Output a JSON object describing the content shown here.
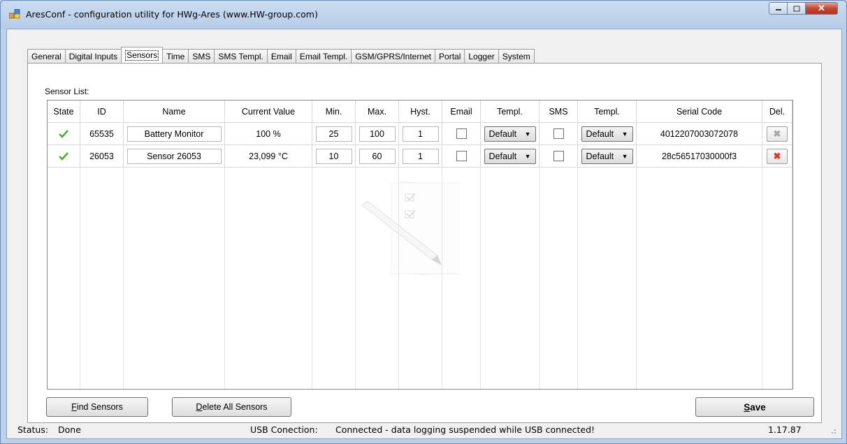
{
  "window": {
    "title": "AresConf - configuration utility for HWg-Ares (www.HW-group.com)",
    "icon": "app-window-icon"
  },
  "tabs": [
    {
      "label": "General"
    },
    {
      "label": "Digital Inputs"
    },
    {
      "label": "Sensors"
    },
    {
      "label": "Time"
    },
    {
      "label": "SMS"
    },
    {
      "label": "SMS Templ."
    },
    {
      "label": "Email"
    },
    {
      "label": "Email Templ."
    },
    {
      "label": "GSM/GPRS/Internet"
    },
    {
      "label": "Portal"
    },
    {
      "label": "Logger"
    },
    {
      "label": "System"
    }
  ],
  "active_tab": "Sensors",
  "sensor_list_label": "Sensor List:",
  "grid": {
    "headers": [
      "State",
      "ID",
      "Name",
      "Current Value",
      "Min.",
      "Max.",
      "Hyst.",
      "Email",
      "Templ.",
      "SMS",
      "Templ.",
      "Serial Code",
      "Del."
    ],
    "rows": [
      {
        "state": "ok",
        "id": "65535",
        "name": "Battery Monitor",
        "value": "100 %",
        "min": "25",
        "max": "100",
        "hyst": "1",
        "email": false,
        "email_templ": "Default",
        "sms": false,
        "sms_templ": "Default",
        "serial": "4012207003072078",
        "delete_enabled": false
      },
      {
        "state": "ok",
        "id": "26053",
        "name": "Sensor 26053",
        "value": "23,099 °C",
        "min": "10",
        "max": "60",
        "hyst": "1",
        "email": false,
        "email_templ": "Default",
        "sms": false,
        "sms_templ": "Default",
        "serial": "28c56517030000f3",
        "delete_enabled": true
      }
    ]
  },
  "buttons": {
    "find": "Find Sensors",
    "find_mnemonic": "F",
    "delete_all": "Delete All Sensors",
    "delete_all_mnemonic": "D",
    "save": "Save",
    "save_mnemonic": "S"
  },
  "status": {
    "left_label": "Status:",
    "left_value": "Done",
    "usb_label": "USB Conection:",
    "usb_value": "Connected - data logging suspended while USB connected!",
    "version": "1.17.87"
  },
  "colors": {
    "check_green": "#4caf2a",
    "delete_red": "#e0341c",
    "delete_gray": "#a8a8a8"
  }
}
